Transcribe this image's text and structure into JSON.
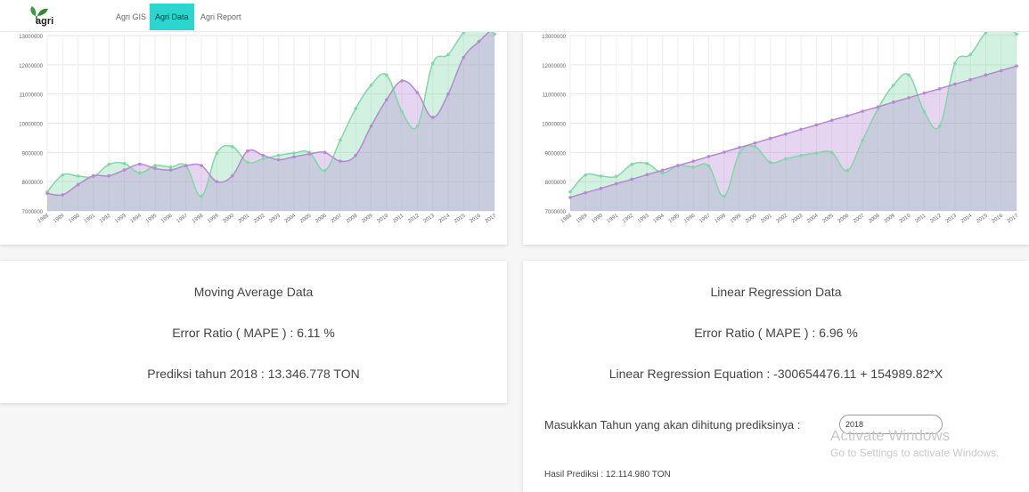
{
  "nav": {
    "logo_text": "agri",
    "items": [
      "Agri GIS",
      "Agri Data",
      "Agri Report"
    ],
    "active_index": 1
  },
  "colors": {
    "actual": "#7fd8a6",
    "forecast": "#b788d3",
    "overlap": "#9dbbb6",
    "active_nav": "#2bd6cf"
  },
  "chart_data": [
    {
      "type": "area",
      "x": [
        1988,
        1989,
        1990,
        1991,
        1992,
        1993,
        1994,
        1995,
        1996,
        1997,
        1998,
        1999,
        2000,
        2001,
        2002,
        2003,
        2004,
        2005,
        2006,
        2007,
        2008,
        2009,
        2010,
        2011,
        2012,
        2013,
        2014,
        2015,
        2016,
        2017
      ],
      "series": [
        {
          "values": [
            7650000,
            8230000,
            8190000,
            8180000,
            8590000,
            8620000,
            8300000,
            8550000,
            8500000,
            8540000,
            7500000,
            8980000,
            9200000,
            8660000,
            8780000,
            8900000,
            8980000,
            9000000,
            8380000,
            9420000,
            10500000,
            11300000,
            11650000,
            10400000,
            9900000,
            12050000,
            12350000,
            13100000,
            13400000,
            13050000
          ]
        },
        {
          "values": [
            7600000,
            7550000,
            7900000,
            8200000,
            8200000,
            8400000,
            8600000,
            8450000,
            8400000,
            8550000,
            8550000,
            8000000,
            8200000,
            9050000,
            8900000,
            8750000,
            8850000,
            8950000,
            9000000,
            8700000,
            8900000,
            9900000,
            10800000,
            11450000,
            11050000,
            10200000,
            11000000,
            12250000,
            12800000,
            13300000
          ]
        }
      ],
      "ylim": [
        7000000,
        13000000
      ],
      "yticks": [
        7000000,
        8000000,
        9000000,
        10000000,
        11000000,
        12000000,
        13000000
      ],
      "grid": true
    },
    {
      "type": "area",
      "x": [
        1988,
        1989,
        1990,
        1991,
        1992,
        1993,
        1994,
        1995,
        1996,
        1997,
        1998,
        1999,
        2000,
        2001,
        2002,
        2003,
        2004,
        2005,
        2006,
        2007,
        2008,
        2009,
        2010,
        2011,
        2012,
        2013,
        2014,
        2015,
        2016,
        2017
      ],
      "series": [
        {
          "values": [
            7650000,
            8230000,
            8190000,
            8180000,
            8590000,
            8620000,
            8300000,
            8550000,
            8500000,
            8540000,
            7500000,
            8980000,
            9200000,
            8660000,
            8780000,
            8900000,
            8980000,
            9000000,
            8380000,
            9420000,
            10500000,
            11300000,
            11650000,
            10400000,
            9900000,
            12050000,
            12350000,
            13100000,
            13400000,
            13050000
          ]
        },
        {
          "values": [
            7460000,
            7620000,
            7770000,
            7930000,
            8080000,
            8240000,
            8390000,
            8550000,
            8700000,
            8860000,
            9010000,
            9170000,
            9320000,
            9480000,
            9630000,
            9790000,
            9940000,
            10100000,
            10250000,
            10410000,
            10560000,
            10720000,
            10870000,
            11030000,
            11180000,
            11340000,
            11490000,
            11650000,
            11800000,
            11960000
          ]
        }
      ],
      "ylim": [
        7000000,
        13000000
      ],
      "yticks": [
        7000000,
        8000000,
        9000000,
        10000000,
        11000000,
        12000000,
        13000000
      ],
      "grid": true
    }
  ],
  "ma": {
    "title": "Moving Average Data",
    "mape": "Error Ratio ( MAPE ) : 6.11 %",
    "prediction": "Prediksi tahun 2018 : 13.346.778 TON"
  },
  "lr": {
    "title": "Linear Regression Data",
    "mape": "Error Ratio ( MAPE ) : 6.96 %",
    "equation": "Linear Regression Equation : -300654476.11 + 154989.82*X",
    "input_label": "Masukkan Tahun yang akan dihitung prediksinya :",
    "input_value": "2018",
    "result": "Hasil Prediksi : 12.114.980 TON"
  },
  "watermark": {
    "line1": "Activate Windows",
    "line2": "Go to Settings to activate Windows."
  }
}
